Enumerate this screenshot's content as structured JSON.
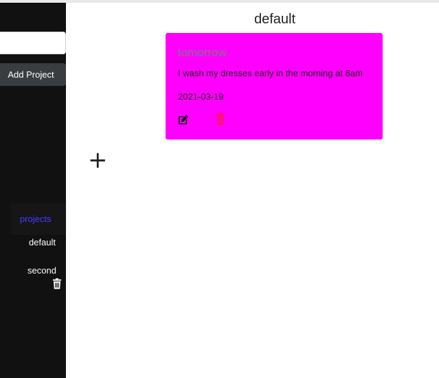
{
  "sidebar": {
    "project_input_value": "",
    "add_project_label": "Add Project",
    "projects_heading": "projects",
    "projects": [
      {
        "name": "default"
      },
      {
        "name": "second"
      }
    ]
  },
  "main": {
    "title": "default",
    "add_todo_label": "+",
    "todos": [
      {
        "title": "tomorrow",
        "description": "I wash my dresses early in the morning at 8am",
        "date": "2021-03-19"
      }
    ]
  },
  "icons": {
    "edit": "edit-icon",
    "delete": "trash-icon",
    "project_delete": "trash-icon"
  },
  "colors": {
    "sidebar_bg": "#111111",
    "card_bg": "#ff00ff",
    "projects_heading": "#4a3bff",
    "delete_icon": "#ff1744",
    "button_bg": "#3a3d40"
  }
}
